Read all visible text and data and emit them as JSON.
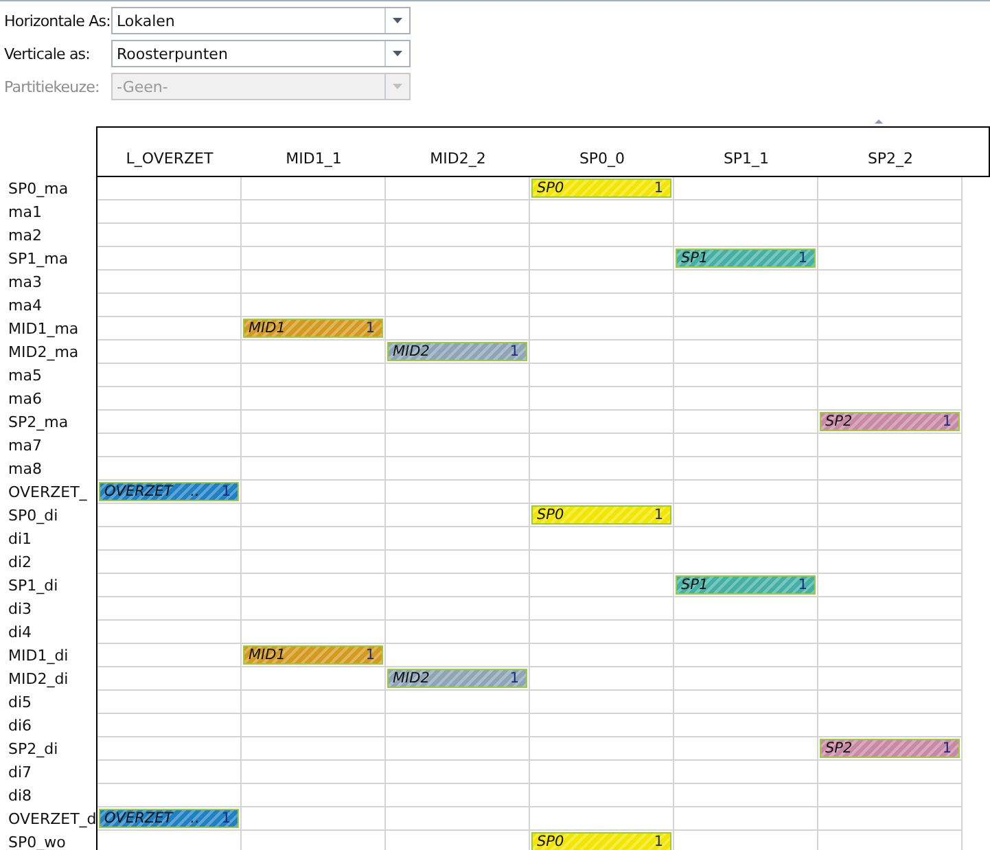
{
  "selectors": [
    {
      "label": "Horizontale As:",
      "value": "Lokalen",
      "disabled": false
    },
    {
      "label": "Verticale as:",
      "value": "Roosterpunten",
      "disabled": false
    },
    {
      "label": "Partitiekeuze:",
      "value": "-Geen-",
      "disabled": true
    }
  ],
  "grid": {
    "columns": [
      "L_OVERZET",
      "MID1_1",
      "MID2_2",
      "SP0_0",
      "SP1_1",
      "SP2_2"
    ],
    "rows": [
      {
        "label": "SP0_ma",
        "cells": [
          {
            "kind": "empty"
          },
          {
            "kind": "empty"
          },
          {
            "kind": "empty"
          },
          {
            "kind": "bar",
            "label": "SP0",
            "count": "1",
            "color": "#f2e600"
          },
          {
            "kind": "empty"
          },
          {
            "kind": "empty"
          }
        ]
      },
      {
        "label": "ma1",
        "cells": [
          {
            "kind": "empty"
          },
          {
            "kind": "empty"
          },
          {
            "kind": "empty"
          },
          {
            "kind": "empty"
          },
          {
            "kind": "empty"
          },
          {
            "kind": "empty"
          }
        ]
      },
      {
        "label": "ma2",
        "cells": [
          {
            "kind": "empty"
          },
          {
            "kind": "empty"
          },
          {
            "kind": "empty"
          },
          {
            "kind": "empty"
          },
          {
            "kind": "empty"
          },
          {
            "kind": "empty"
          }
        ]
      },
      {
        "label": "SP1_ma",
        "cells": [
          {
            "kind": "empty"
          },
          {
            "kind": "empty"
          },
          {
            "kind": "empty"
          },
          {
            "kind": "empty"
          },
          {
            "kind": "bar",
            "label": "SP1",
            "count": "1",
            "color": "#45b0a6"
          },
          {
            "kind": "empty"
          }
        ]
      },
      {
        "label": "ma3",
        "cells": [
          {
            "kind": "empty"
          },
          {
            "kind": "empty"
          },
          {
            "kind": "empty"
          },
          {
            "kind": "empty"
          },
          {
            "kind": "empty"
          },
          {
            "kind": "empty"
          }
        ]
      },
      {
        "label": "ma4",
        "cells": [
          {
            "kind": "empty"
          },
          {
            "kind": "empty"
          },
          {
            "kind": "empty"
          },
          {
            "kind": "empty"
          },
          {
            "kind": "empty"
          },
          {
            "kind": "empty"
          }
        ]
      },
      {
        "label": "MID1_ma",
        "cells": [
          {
            "kind": "empty"
          },
          {
            "kind": "bar",
            "label": "MID1",
            "count": "1",
            "color": "#d39a1f"
          },
          {
            "kind": "empty"
          },
          {
            "kind": "empty"
          },
          {
            "kind": "empty"
          },
          {
            "kind": "empty"
          }
        ]
      },
      {
        "label": "MID2_ma",
        "cells": [
          {
            "kind": "empty"
          },
          {
            "kind": "empty"
          },
          {
            "kind": "bar",
            "label": "MID2",
            "count": "1",
            "color": "#8ea5b6"
          },
          {
            "kind": "empty"
          },
          {
            "kind": "empty"
          },
          {
            "kind": "empty"
          }
        ]
      },
      {
        "label": "ma5",
        "cells": [
          {
            "kind": "empty"
          },
          {
            "kind": "empty"
          },
          {
            "kind": "empty"
          },
          {
            "kind": "empty"
          },
          {
            "kind": "empty"
          },
          {
            "kind": "empty"
          }
        ]
      },
      {
        "label": "ma6",
        "cells": [
          {
            "kind": "empty"
          },
          {
            "kind": "empty"
          },
          {
            "kind": "empty"
          },
          {
            "kind": "empty"
          },
          {
            "kind": "empty"
          },
          {
            "kind": "empty"
          }
        ]
      },
      {
        "label": "SP2_ma",
        "cells": [
          {
            "kind": "empty"
          },
          {
            "kind": "empty"
          },
          {
            "kind": "empty"
          },
          {
            "kind": "empty"
          },
          {
            "kind": "empty"
          },
          {
            "kind": "bar",
            "label": "SP2",
            "count": "1",
            "color": "#c889a6"
          }
        ]
      },
      {
        "label": "ma7",
        "cells": [
          {
            "kind": "empty"
          },
          {
            "kind": "empty"
          },
          {
            "kind": "empty"
          },
          {
            "kind": "empty"
          },
          {
            "kind": "empty"
          },
          {
            "kind": "empty"
          }
        ]
      },
      {
        "label": "ma8",
        "cells": [
          {
            "kind": "empty"
          },
          {
            "kind": "empty"
          },
          {
            "kind": "empty"
          },
          {
            "kind": "empty"
          },
          {
            "kind": "empty"
          },
          {
            "kind": "empty"
          }
        ]
      },
      {
        "label": "OVERZET_",
        "cells": [
          {
            "kind": "bar",
            "label": "OVERZET",
            "more": "..",
            "count": "1",
            "color": "#1f80c4"
          },
          {
            "kind": "empty"
          },
          {
            "kind": "empty"
          },
          {
            "kind": "empty"
          },
          {
            "kind": "empty"
          },
          {
            "kind": "empty"
          }
        ]
      },
      {
        "label": "SP0_di",
        "cells": [
          {
            "kind": "empty"
          },
          {
            "kind": "empty"
          },
          {
            "kind": "empty"
          },
          {
            "kind": "bar",
            "label": "SP0",
            "count": "1",
            "color": "#f2e600"
          },
          {
            "kind": "empty"
          },
          {
            "kind": "empty"
          }
        ]
      },
      {
        "label": "di1",
        "cells": [
          {
            "kind": "empty"
          },
          {
            "kind": "empty"
          },
          {
            "kind": "empty"
          },
          {
            "kind": "empty"
          },
          {
            "kind": "empty"
          },
          {
            "kind": "empty"
          }
        ]
      },
      {
        "label": "di2",
        "cells": [
          {
            "kind": "empty"
          },
          {
            "kind": "empty"
          },
          {
            "kind": "empty"
          },
          {
            "kind": "empty"
          },
          {
            "kind": "empty"
          },
          {
            "kind": "empty"
          }
        ]
      },
      {
        "label": "SP1_di",
        "cells": [
          {
            "kind": "empty"
          },
          {
            "kind": "empty"
          },
          {
            "kind": "empty"
          },
          {
            "kind": "empty"
          },
          {
            "kind": "bar",
            "label": "SP1",
            "count": "1",
            "color": "#45b0a6"
          },
          {
            "kind": "empty"
          }
        ]
      },
      {
        "label": "di3",
        "cells": [
          {
            "kind": "empty"
          },
          {
            "kind": "empty"
          },
          {
            "kind": "empty"
          },
          {
            "kind": "empty"
          },
          {
            "kind": "empty"
          },
          {
            "kind": "empty"
          }
        ]
      },
      {
        "label": "di4",
        "cells": [
          {
            "kind": "empty"
          },
          {
            "kind": "empty"
          },
          {
            "kind": "empty"
          },
          {
            "kind": "empty"
          },
          {
            "kind": "empty"
          },
          {
            "kind": "empty"
          }
        ]
      },
      {
        "label": "MID1_di",
        "cells": [
          {
            "kind": "empty"
          },
          {
            "kind": "bar",
            "label": "MID1",
            "count": "1",
            "color": "#d39a1f"
          },
          {
            "kind": "empty"
          },
          {
            "kind": "empty"
          },
          {
            "kind": "empty"
          },
          {
            "kind": "empty"
          }
        ]
      },
      {
        "label": "MID2_di",
        "cells": [
          {
            "kind": "empty"
          },
          {
            "kind": "empty"
          },
          {
            "kind": "bar",
            "label": "MID2",
            "count": "1",
            "color": "#8ea5b6"
          },
          {
            "kind": "empty"
          },
          {
            "kind": "empty"
          },
          {
            "kind": "empty"
          }
        ]
      },
      {
        "label": "di5",
        "cells": [
          {
            "kind": "empty"
          },
          {
            "kind": "empty"
          },
          {
            "kind": "empty"
          },
          {
            "kind": "empty"
          },
          {
            "kind": "empty"
          },
          {
            "kind": "empty"
          }
        ]
      },
      {
        "label": "di6",
        "cells": [
          {
            "kind": "empty"
          },
          {
            "kind": "empty"
          },
          {
            "kind": "empty"
          },
          {
            "kind": "empty"
          },
          {
            "kind": "empty"
          },
          {
            "kind": "empty"
          }
        ]
      },
      {
        "label": "SP2_di",
        "cells": [
          {
            "kind": "empty"
          },
          {
            "kind": "empty"
          },
          {
            "kind": "empty"
          },
          {
            "kind": "empty"
          },
          {
            "kind": "empty"
          },
          {
            "kind": "bar",
            "label": "SP2",
            "count": "1",
            "color": "#c889a6"
          }
        ]
      },
      {
        "label": "di7",
        "cells": [
          {
            "kind": "empty"
          },
          {
            "kind": "empty"
          },
          {
            "kind": "empty"
          },
          {
            "kind": "empty"
          },
          {
            "kind": "empty"
          },
          {
            "kind": "empty"
          }
        ]
      },
      {
        "label": "di8",
        "cells": [
          {
            "kind": "empty"
          },
          {
            "kind": "empty"
          },
          {
            "kind": "empty"
          },
          {
            "kind": "empty"
          },
          {
            "kind": "empty"
          },
          {
            "kind": "empty"
          }
        ]
      },
      {
        "label": "OVERZET_d",
        "cells": [
          {
            "kind": "bar",
            "label": "OVERZET",
            "more": "..",
            "count": "1",
            "color": "#1f80c4"
          },
          {
            "kind": "empty"
          },
          {
            "kind": "empty"
          },
          {
            "kind": "empty"
          },
          {
            "kind": "empty"
          },
          {
            "kind": "empty"
          }
        ]
      },
      {
        "label": "SP0_wo",
        "cells": [
          {
            "kind": "empty"
          },
          {
            "kind": "empty"
          },
          {
            "kind": "empty"
          },
          {
            "kind": "bar",
            "label": "SP0",
            "count": "1",
            "color": "#f2e600"
          },
          {
            "kind": "empty"
          },
          {
            "kind": "empty"
          }
        ]
      }
    ]
  }
}
